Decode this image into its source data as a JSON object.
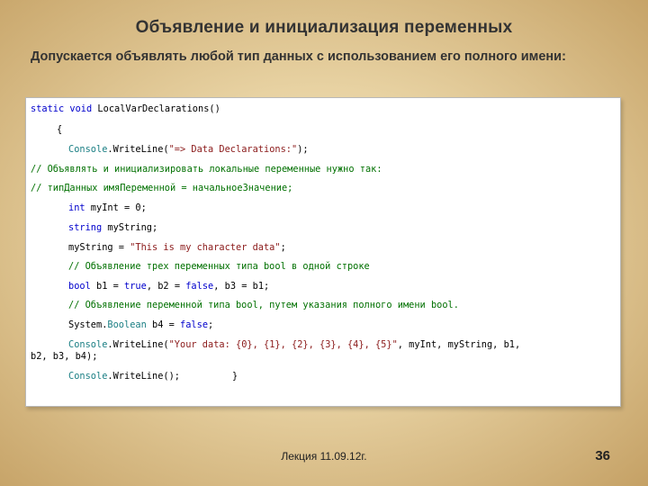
{
  "slide": {
    "title": "Объявление и инициализация переменных",
    "subtitle": "Допускается объявлять любой тип данных с использованием его полного имени:",
    "footer": "Лекция 11.09.12г.",
    "page_number": "36"
  },
  "code": {
    "l1_kw1": "static",
    "l1_kw2": "void",
    "l1_rest": "LocalVarDeclarations()",
    "l2": "{",
    "l3_cls": "Console",
    "l3_mid": ".WriteLine(",
    "l3_str": "\"=> Data Declarations:\"",
    "l3_end": ");",
    "l4_comment": "// Объявлять и инициализировать локальные переменные нужно так:",
    "l5_comment": "// типДанных имяПеременной = начальноеЗначение;",
    "l6_kw": "int",
    "l6_rest": " myInt = 0;",
    "l7_kw": "string",
    "l7_rest": " myString;",
    "l8_pre": "myString = ",
    "l8_str": "\"This is my character data\"",
    "l8_end": ";",
    "l9_comment": "// Объявление трех переменных типа bool в одной строке",
    "l10_kw1": "bool",
    "l10_a": " b1 = ",
    "l10_kw2": "true",
    "l10_b": ", b2 = ",
    "l10_kw3": "false",
    "l10_c": ", b3 = b1;",
    "l11_comment": "// Объявление переменной типа bool, путем указания полного имени bool.",
    "l12_a": "System.",
    "l12_cls": "Boolean",
    "l12_b": " b4 = ",
    "l12_kw": "false",
    "l12_c": ";",
    "l13_cls": "Console",
    "l13_mid": ".WriteLine(",
    "l13_str": "\"Your data: {0}, {1}, {2}, {3}, {4}, {5}\"",
    "l13_end": ", myInt, myString, b1,",
    "l14": "b2, b3, b4);",
    "l15_cls": "Console",
    "l15_end": ".WriteLine();",
    "l15_brace": "}"
  },
  "colors": {
    "keyword": "#0000cc",
    "class": "#1b7f84",
    "string": "#8b1a1a",
    "comment": "#007000"
  }
}
